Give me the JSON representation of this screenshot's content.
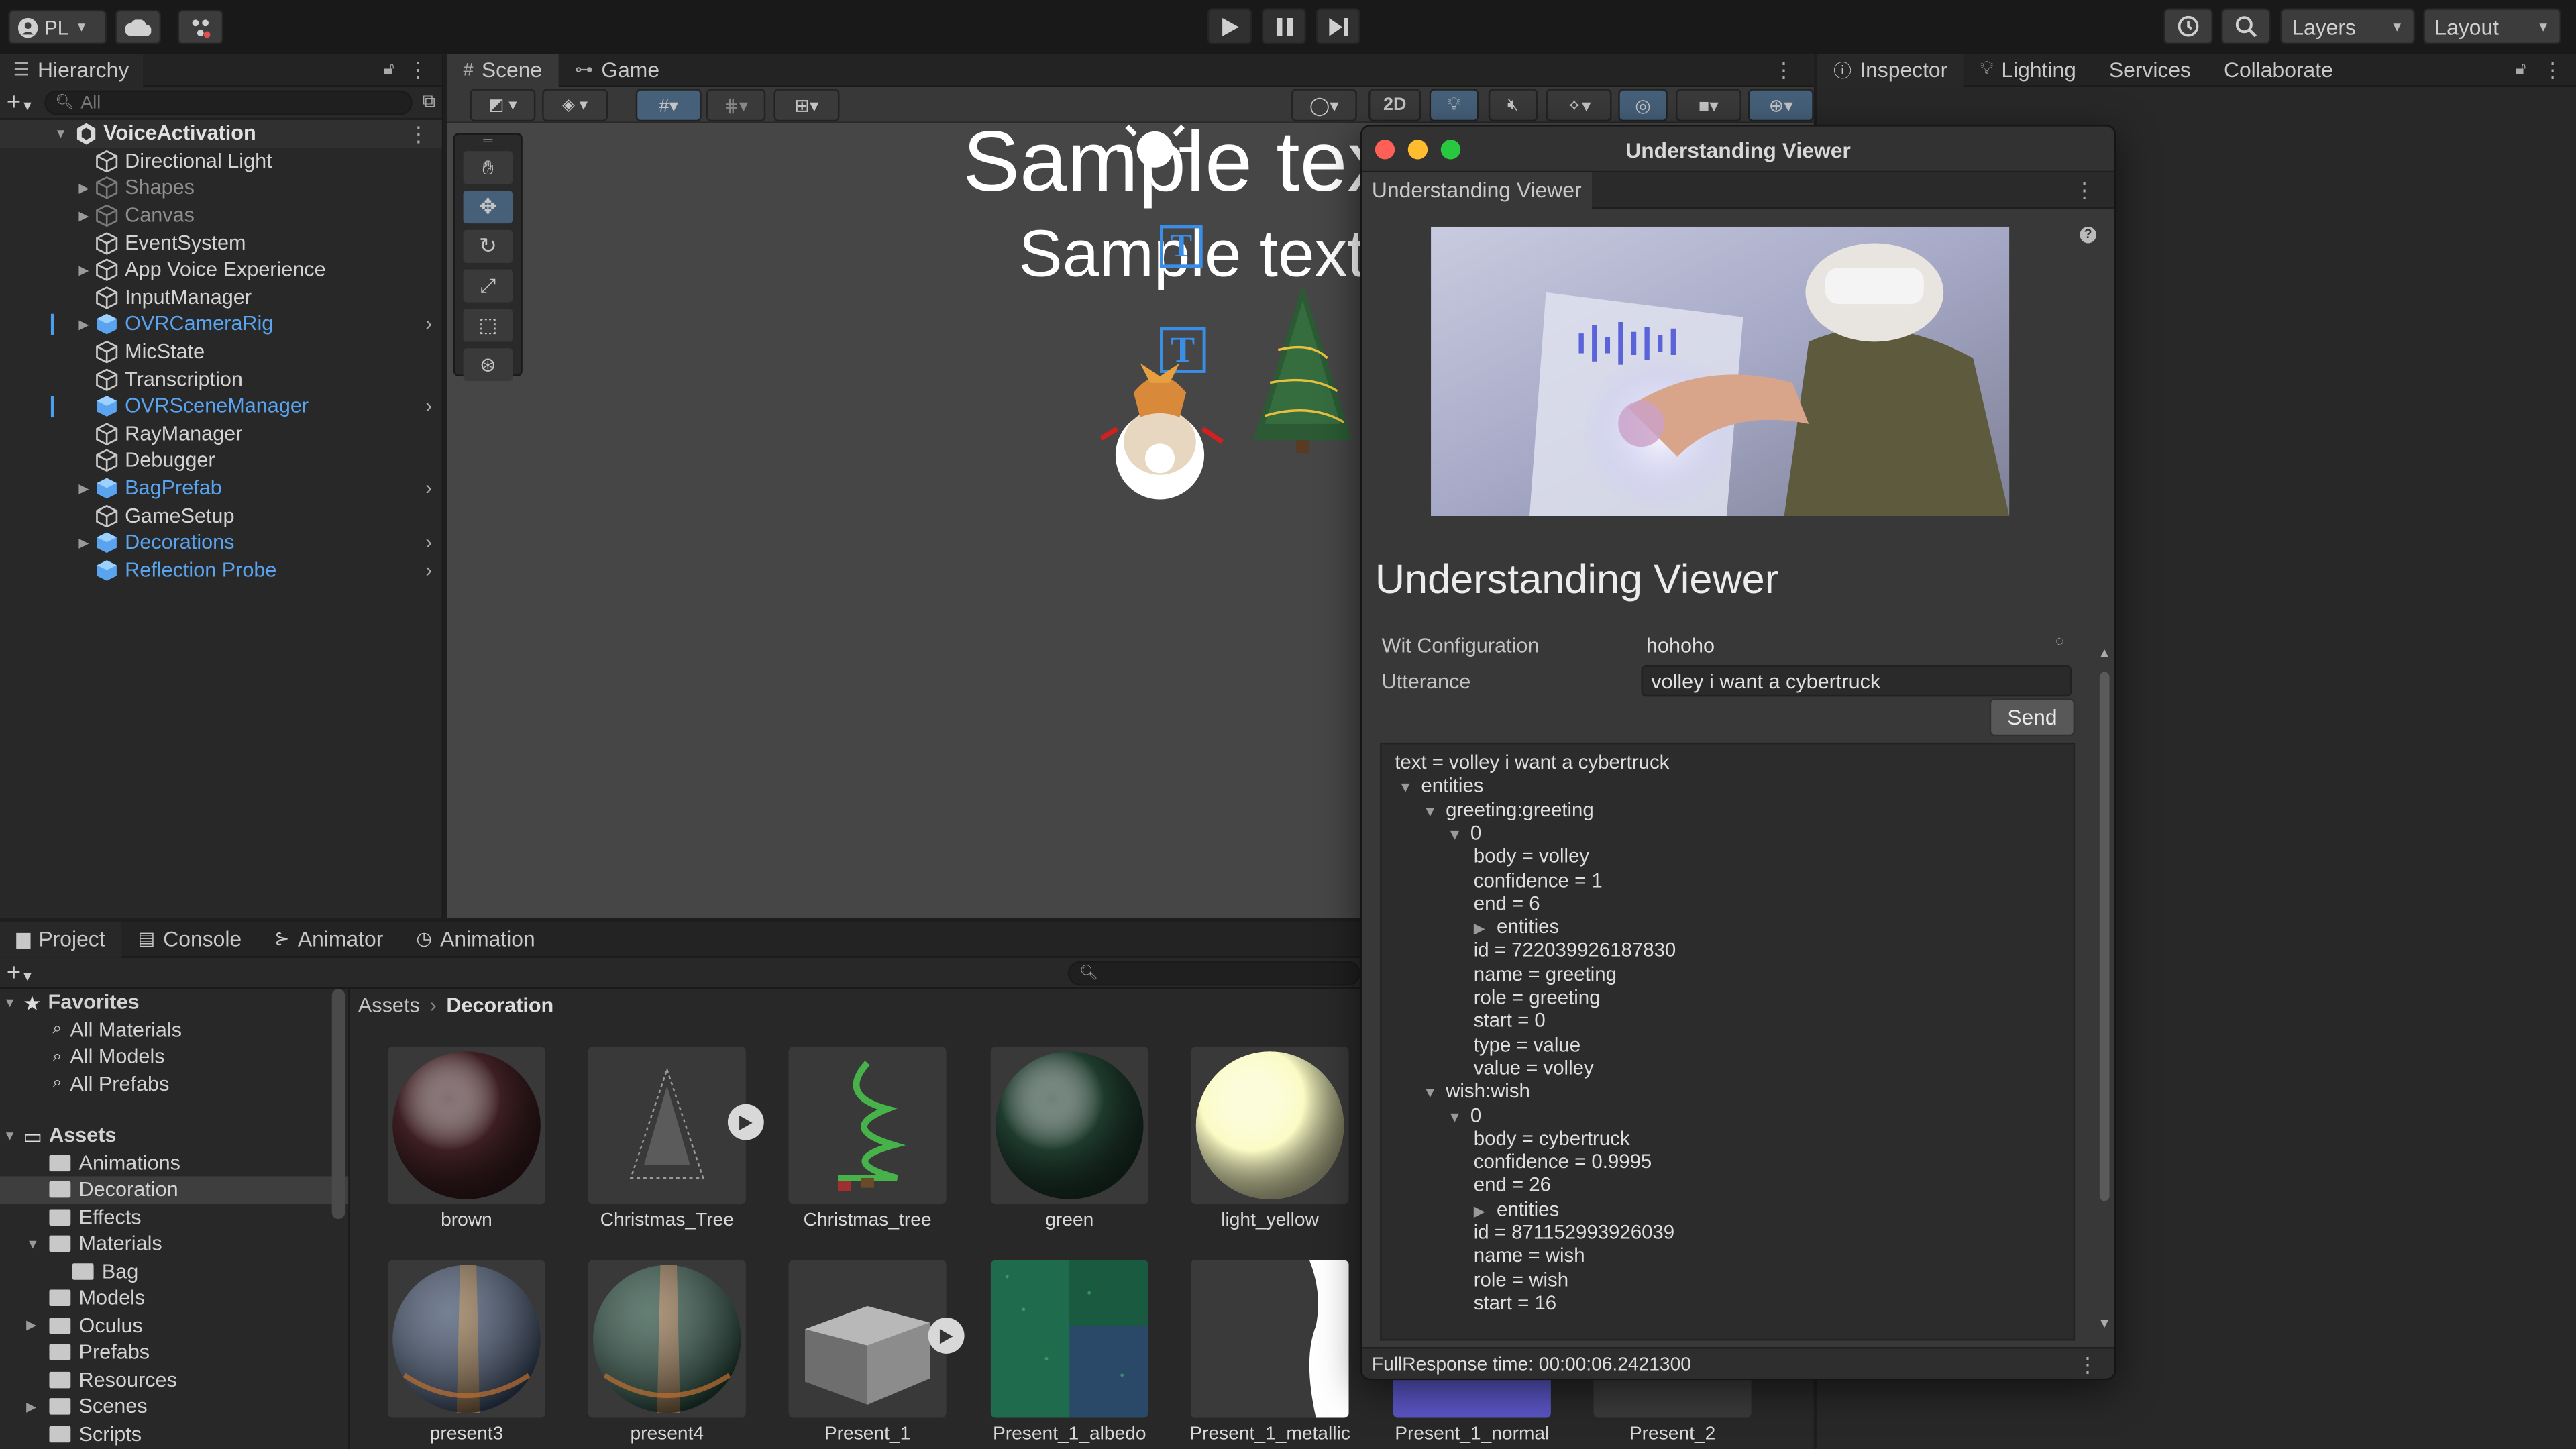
{
  "toolbar": {
    "account_label": "PL",
    "layers_label": "Layers",
    "layout_label": "Layout"
  },
  "hierarchy": {
    "tab_label": "Hierarchy",
    "search_placeholder": "All",
    "root": "VoiceActivation",
    "items": [
      {
        "label": "Directional Light",
        "style": "normal",
        "expandable": false,
        "prefab": false
      },
      {
        "label": "Shapes",
        "style": "dim",
        "expandable": true,
        "prefab": false
      },
      {
        "label": "Canvas",
        "style": "dim",
        "expandable": true,
        "prefab": false
      },
      {
        "label": "EventSystem",
        "style": "normal",
        "expandable": false,
        "prefab": false
      },
      {
        "label": "App Voice Experience",
        "style": "normal",
        "expandable": true,
        "prefab": false
      },
      {
        "label": "InputManager",
        "style": "normal",
        "expandable": false,
        "prefab": false
      },
      {
        "label": "OVRCameraRig",
        "style": "blue",
        "expandable": true,
        "prefab": true
      },
      {
        "label": "MicState",
        "style": "normal",
        "expandable": false,
        "prefab": false
      },
      {
        "label": "Transcription",
        "style": "normal",
        "expandable": false,
        "prefab": false
      },
      {
        "label": "OVRSceneManager",
        "style": "blue",
        "expandable": false,
        "prefab": true
      },
      {
        "label": "RayManager",
        "style": "normal",
        "expandable": false,
        "prefab": false
      },
      {
        "label": "Debugger",
        "style": "normal",
        "expandable": false,
        "prefab": false
      },
      {
        "label": "BagPrefab",
        "style": "blue",
        "expandable": true,
        "prefab": true
      },
      {
        "label": "GameSetup",
        "style": "normal",
        "expandable": false,
        "prefab": false
      },
      {
        "label": "Decorations",
        "style": "blue",
        "expandable": true,
        "prefab": true
      },
      {
        "label": "Reflection Probe",
        "style": "blue",
        "expandable": false,
        "prefab": true
      }
    ]
  },
  "scene": {
    "tab_scene": "Scene",
    "tab_game": "Game",
    "mode_2d": "2D",
    "text_large": "Sample tex",
    "text_small": "Sample text"
  },
  "right_tabs": {
    "inspector": "Inspector",
    "lighting": "Lighting",
    "services": "Services",
    "collaborate": "Collaborate"
  },
  "viewer": {
    "window_title": "Understanding Viewer",
    "tab_label": "Understanding Viewer",
    "heading": "Understanding Viewer",
    "wit_label": "Wit Configuration",
    "wit_value": "hohoho",
    "utterance_label": "Utterance",
    "utterance_value": "volley i want a cybertruck",
    "send_label": "Send",
    "response_lines": [
      {
        "text": "text = volley i want a cybertruck",
        "indent": 0,
        "arrow": ""
      },
      {
        "text": "entities",
        "indent": 1,
        "arrow": "down"
      },
      {
        "text": "greeting:greeting",
        "indent": 2,
        "arrow": "down"
      },
      {
        "text": "0",
        "indent": 3,
        "arrow": "down"
      },
      {
        "text": "body = volley",
        "indent": 4,
        "arrow": ""
      },
      {
        "text": "confidence = 1",
        "indent": 4,
        "arrow": ""
      },
      {
        "text": "end = 6",
        "indent": 4,
        "arrow": ""
      },
      {
        "text": "entities",
        "indent": 4,
        "arrow": "right"
      },
      {
        "text": "id = 722039926187830",
        "indent": 4,
        "arrow": ""
      },
      {
        "text": "name = greeting",
        "indent": 4,
        "arrow": ""
      },
      {
        "text": "role = greeting",
        "indent": 4,
        "arrow": ""
      },
      {
        "text": "start = 0",
        "indent": 4,
        "arrow": ""
      },
      {
        "text": "type = value",
        "indent": 4,
        "arrow": ""
      },
      {
        "text": "value = volley",
        "indent": 4,
        "arrow": ""
      },
      {
        "text": "wish:wish",
        "indent": 2,
        "arrow": "down"
      },
      {
        "text": "0",
        "indent": 3,
        "arrow": "down"
      },
      {
        "text": "body = cybertruck",
        "indent": 4,
        "arrow": ""
      },
      {
        "text": "confidence = 0.9995",
        "indent": 4,
        "arrow": ""
      },
      {
        "text": "end = 26",
        "indent": 4,
        "arrow": ""
      },
      {
        "text": "entities",
        "indent": 4,
        "arrow": "right"
      },
      {
        "text": "id = 871152993926039",
        "indent": 4,
        "arrow": ""
      },
      {
        "text": "name = wish",
        "indent": 4,
        "arrow": ""
      },
      {
        "text": "role = wish",
        "indent": 4,
        "arrow": ""
      },
      {
        "text": "start = 16",
        "indent": 4,
        "arrow": ""
      }
    ],
    "status": "FullResponse time: 00:00:06.2421300"
  },
  "bottom_tabs": {
    "project": "Project",
    "console": "Console",
    "animator": "Animator",
    "animation": "Animation"
  },
  "project": {
    "favorites_label": "Favorites",
    "favorites": [
      "All Materials",
      "All Models",
      "All Prefabs"
    ],
    "assets_label": "Assets",
    "folders": [
      {
        "label": "Animations",
        "level": 1,
        "expandable": false,
        "open": false
      },
      {
        "label": "Decoration",
        "level": 1,
        "expandable": false,
        "open": false
      },
      {
        "label": "Effects",
        "level": 1,
        "expandable": false,
        "open": false
      },
      {
        "label": "Materials",
        "level": 1,
        "expandable": true,
        "open": true
      },
      {
        "label": "Bag",
        "level": 2,
        "expandable": false,
        "open": false
      },
      {
        "label": "Models",
        "level": 1,
        "expandable": false,
        "open": false
      },
      {
        "label": "Oculus",
        "level": 1,
        "expandable": true,
        "open": false
      },
      {
        "label": "Prefabs",
        "level": 1,
        "expandable": false,
        "open": false
      },
      {
        "label": "Resources",
        "level": 1,
        "expandable": false,
        "open": false
      },
      {
        "label": "Scenes",
        "level": 1,
        "expandable": true,
        "open": false
      },
      {
        "label": "Scripts",
        "level": 1,
        "expandable": false,
        "open": false
      }
    ],
    "breadcrumb_root": "Assets",
    "breadcrumb_current": "Decoration",
    "assets": [
      {
        "label": "brown",
        "kind": "sphere",
        "color": "#3d1f22"
      },
      {
        "label": "Christmas_Tree",
        "kind": "tree-white",
        "color": "#9a9a9a"
      },
      {
        "label": "Christmas_tree",
        "kind": "tree-green",
        "color": "#3b7a3b"
      },
      {
        "label": "green",
        "kind": "sphere",
        "color": "#1f3b2e"
      },
      {
        "label": "light_yellow",
        "kind": "sphere",
        "color": "#fafbc4"
      },
      {
        "label": "present3",
        "kind": "present-blue",
        "color": "#3a4a66"
      },
      {
        "label": "present4",
        "kind": "present-green",
        "color": "#23483a"
      },
      {
        "label": "Present_1",
        "kind": "box",
        "color": "#8a8a8a"
      },
      {
        "label": "Present_1_albedo",
        "kind": "tex-albedo",
        "color": "#1f6b4e"
      },
      {
        "label": "Present_1_metallic",
        "kind": "tex-metal",
        "color": "#ffffff"
      },
      {
        "label": "Present_1_normal",
        "kind": "tex-normal",
        "color": "#6b63d6"
      },
      {
        "label": "Present_2",
        "kind": "plain",
        "color": "#3a3a3a"
      }
    ]
  },
  "colors": {
    "selection_blue": "#2c5d87",
    "prefab_blue": "#5aa4ef",
    "close_red": "#fe5f57",
    "minimize_yellow": "#febc2e",
    "zoom_green": "#28c840"
  }
}
